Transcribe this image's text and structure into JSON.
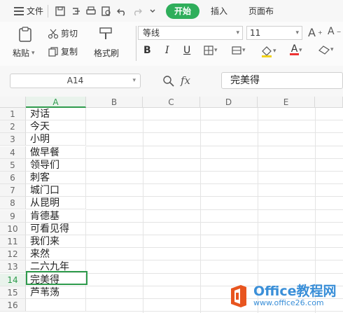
{
  "menubar": {
    "file_label": "文件",
    "tabs": [
      "开始",
      "插入",
      "页面布"
    ],
    "active_tab": "开始"
  },
  "ribbon": {
    "paste_label": "粘贴",
    "cut_label": "剪切",
    "copy_label": "复制",
    "format_painter_label": "格式刷",
    "font_name": "等线",
    "font_size": "11",
    "bold": "B",
    "italic": "I",
    "underline": "U",
    "font_color_letter": "A"
  },
  "formula_bar": {
    "name_box": "A14",
    "fx": "fx",
    "formula_value": "完美得"
  },
  "sheet": {
    "columns": [
      "A",
      "B",
      "C",
      "D",
      "E"
    ],
    "selected_column": "A",
    "selected_row": 14,
    "rows": [
      {
        "num": "1",
        "a": "对话"
      },
      {
        "num": "2",
        "a": "今天"
      },
      {
        "num": "3",
        "a": "小明"
      },
      {
        "num": "4",
        "a": "做早餐"
      },
      {
        "num": "5",
        "a": "领导们"
      },
      {
        "num": "6",
        "a": "刺客"
      },
      {
        "num": "7",
        "a": "城门口"
      },
      {
        "num": "8",
        "a": "从昆明"
      },
      {
        "num": "9",
        "a": "肯德基"
      },
      {
        "num": "10",
        "a": "可看见得"
      },
      {
        "num": "11",
        "a": "我们来"
      },
      {
        "num": "12",
        "a": "来然"
      },
      {
        "num": "13",
        "a": "二六九年"
      },
      {
        "num": "14",
        "a": "完美得"
      },
      {
        "num": "15",
        "a": "芦苇荡"
      },
      {
        "num": "16",
        "a": ""
      }
    ]
  },
  "watermark": {
    "title": "Office教程网",
    "url": "www.office26.com"
  },
  "colors": {
    "accent": "#2fae5b",
    "selection": "#2e9b4c",
    "watermark_blue": "#3a8fd8",
    "logo_orange": "#e8551f"
  }
}
